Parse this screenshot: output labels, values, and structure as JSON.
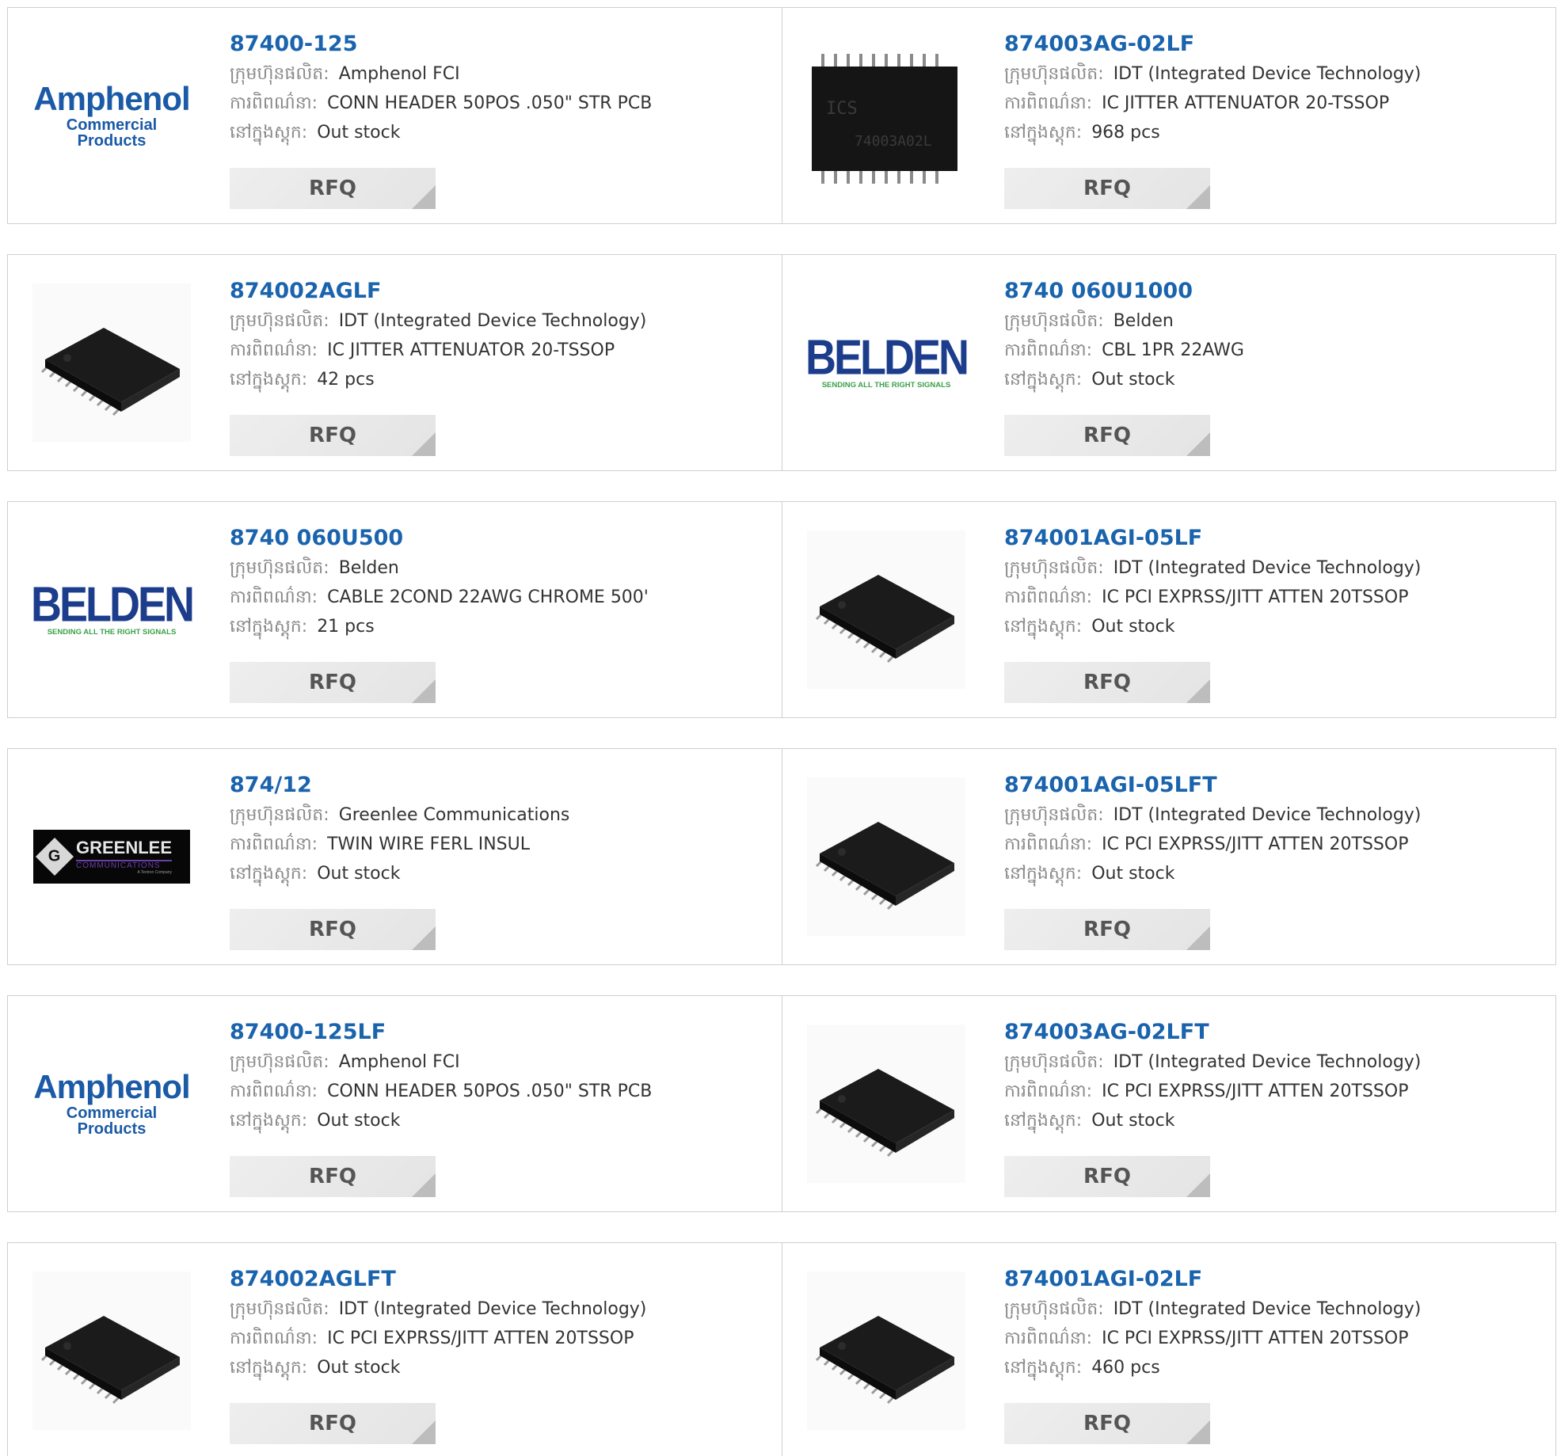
{
  "labels": {
    "manufacturer": "ក្រុមហ៊ុនផលិត:",
    "description": "ការពិពណ៌នា:",
    "stock": "នៅក្នុងស្តុក:",
    "rfq": "RFQ"
  },
  "logos": {
    "amphenol": {
      "line1": "Amphenol",
      "line2": "Commercial Products"
    },
    "belden": {
      "line1": "BELDEN",
      "line2": "SENDING ALL THE RIGHT SIGNALS"
    },
    "greenlee": {
      "mark": "G",
      "line1": "GREENLEE",
      "line2": "COMMUNICATIONS",
      "line3": "A Textron Company"
    },
    "chip_marking": {
      "line1": "ICS",
      "line2": "74003A02L"
    }
  },
  "products": [
    {
      "part": "87400-125",
      "manufacturer": "Amphenol FCI",
      "description": "CONN HEADER 50POS .050\" STR PCB",
      "stock": "Out stock",
      "image": "amphenol"
    },
    {
      "part": "874003AG-02LF",
      "manufacturer": "IDT (Integrated Device Technology)",
      "description": "IC JITTER ATTENUATOR 20-TSSOP",
      "stock": "968 pcs",
      "image": "chip-top"
    },
    {
      "part": "874002AGLF",
      "manufacturer": "IDT (Integrated Device Technology)",
      "description": "IC JITTER ATTENUATOR 20-TSSOP",
      "stock": "42 pcs",
      "image": "chip"
    },
    {
      "part": "8740 060U1000",
      "manufacturer": "Belden",
      "description": "CBL 1PR 22AWG",
      "stock": "Out stock",
      "image": "belden"
    },
    {
      "part": "8740 060U500",
      "manufacturer": "Belden",
      "description": "CABLE 2COND 22AWG CHROME 500'",
      "stock": "21 pcs",
      "image": "belden"
    },
    {
      "part": "874001AGI-05LF",
      "manufacturer": "IDT (Integrated Device Technology)",
      "description": "IC PCI EXPRSS/JITT ATTEN 20TSSOP",
      "stock": "Out stock",
      "image": "chip"
    },
    {
      "part": "874/12",
      "manufacturer": "Greenlee Communications",
      "description": "TWIN WIRE FERL INSUL",
      "stock": "Out stock",
      "image": "greenlee"
    },
    {
      "part": "874001AGI-05LFT",
      "manufacturer": "IDT (Integrated Device Technology)",
      "description": "IC PCI EXPRSS/JITT ATTEN 20TSSOP",
      "stock": "Out stock",
      "image": "chip"
    },
    {
      "part": "87400-125LF",
      "manufacturer": "Amphenol FCI",
      "description": "CONN HEADER 50POS .050\" STR PCB",
      "stock": "Out stock",
      "image": "amphenol"
    },
    {
      "part": "874003AG-02LFT",
      "manufacturer": "IDT (Integrated Device Technology)",
      "description": "IC PCI EXPRSS/JITT ATTEN 20TSSOP",
      "stock": "Out stock",
      "image": "chip"
    },
    {
      "part": "874002AGLFT",
      "manufacturer": "IDT (Integrated Device Technology)",
      "description": "IC PCI EXPRSS/JITT ATTEN 20TSSOP",
      "stock": "Out stock",
      "image": "chip"
    },
    {
      "part": "874001AGI-02LF",
      "manufacturer": "IDT (Integrated Device Technology)",
      "description": "IC PCI EXPRSS/JITT ATTEN 20TSSOP",
      "stock": "460 pcs",
      "image": "chip"
    }
  ]
}
